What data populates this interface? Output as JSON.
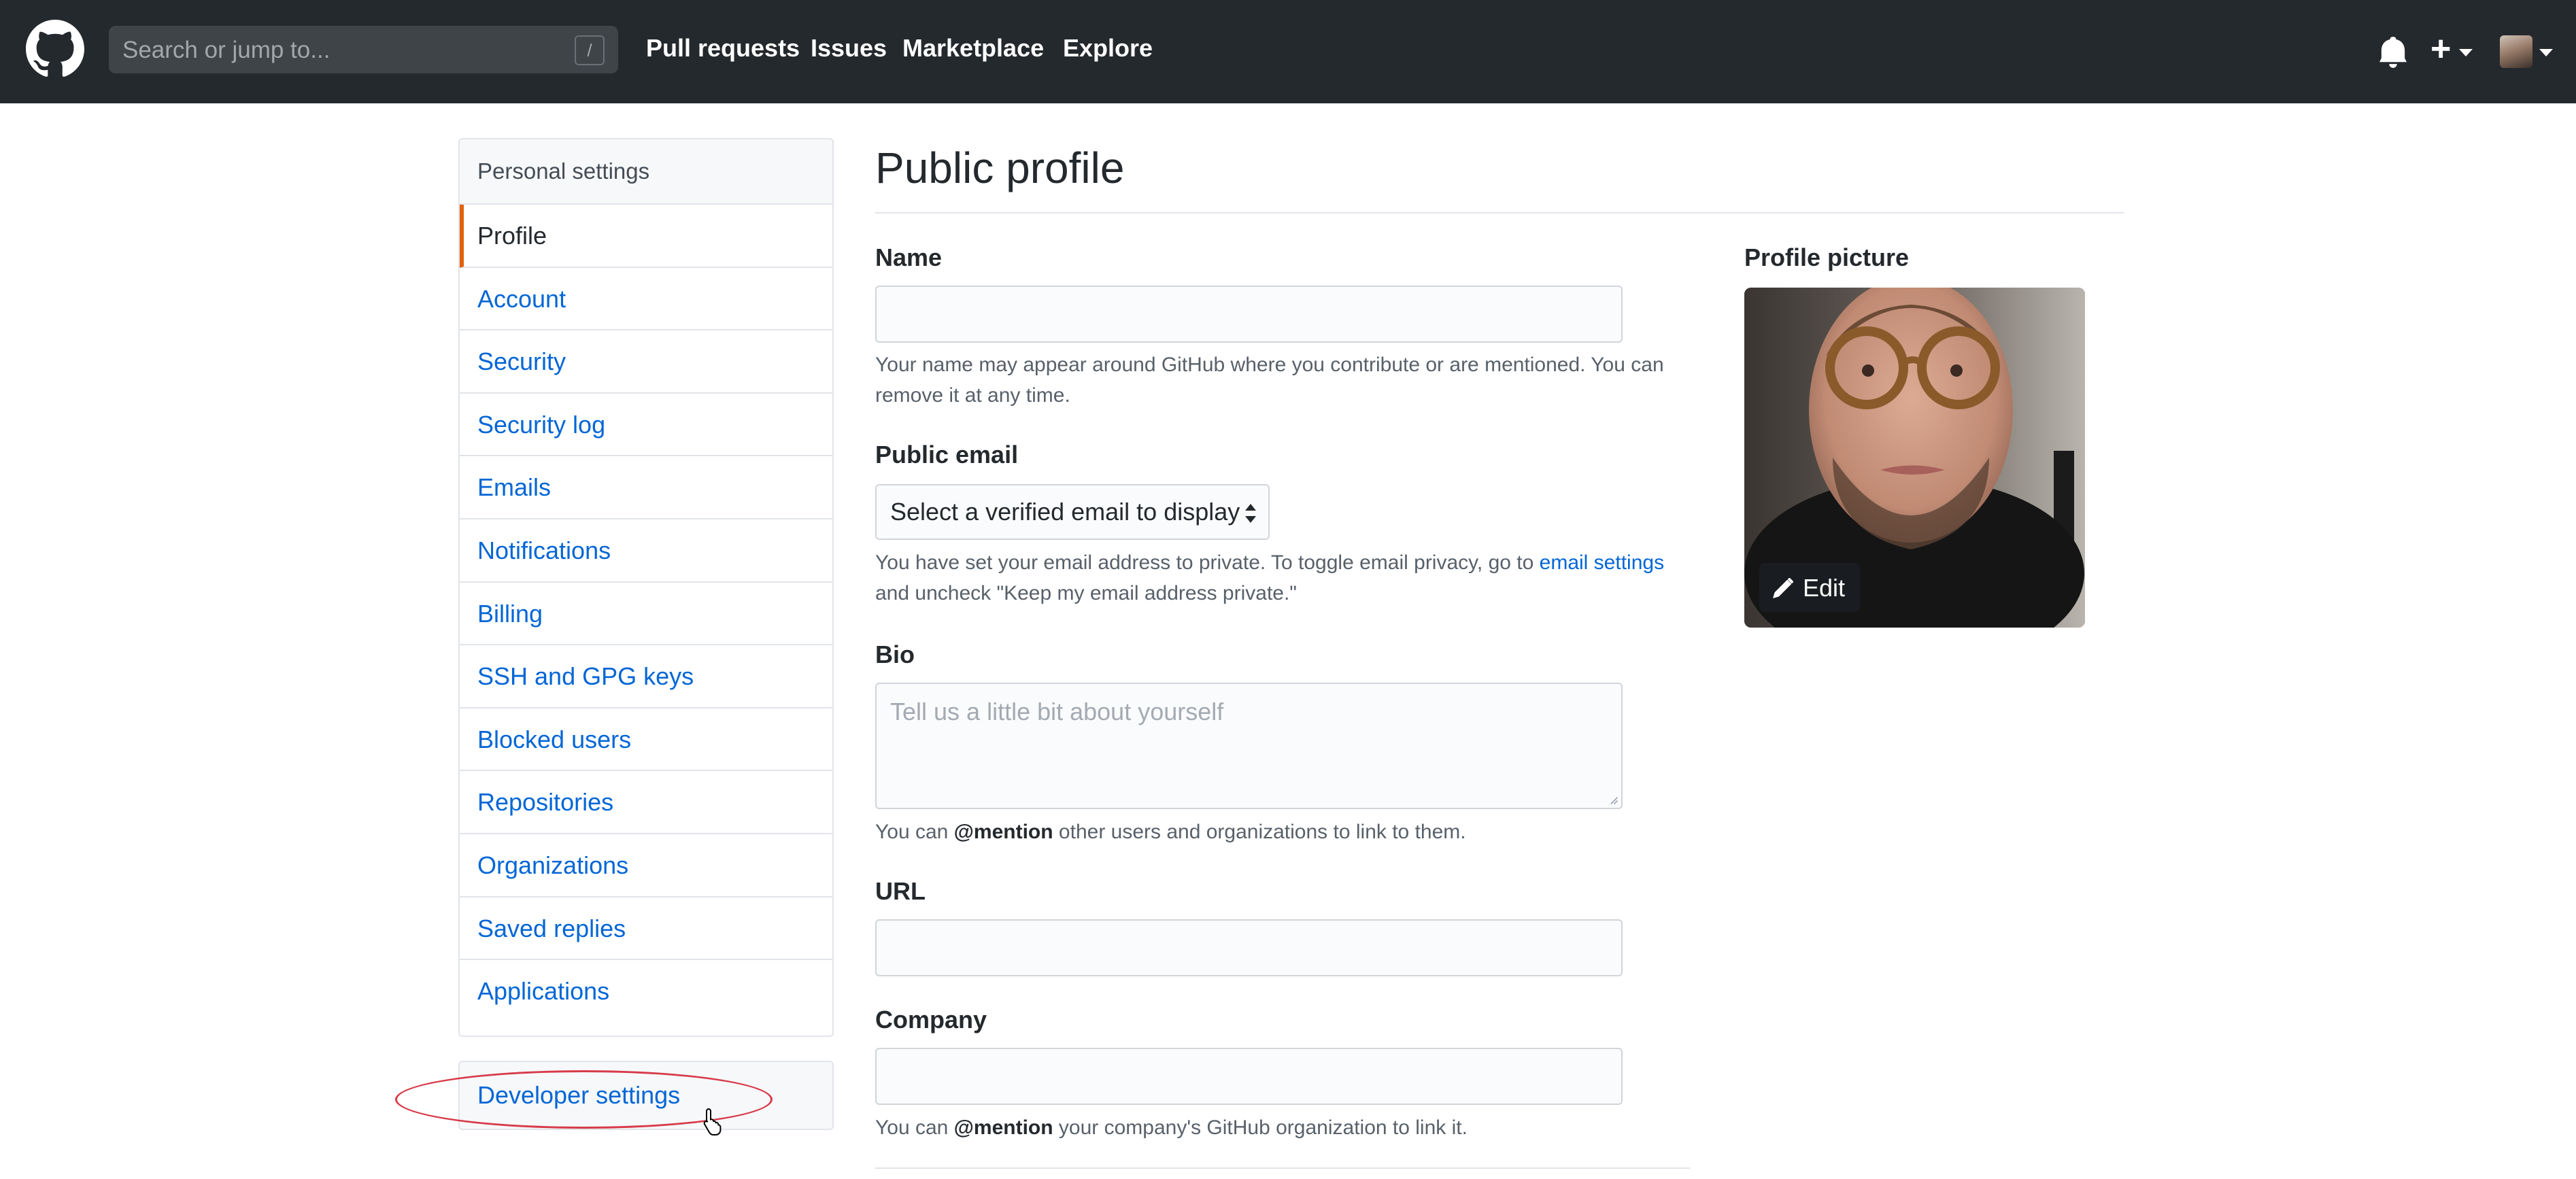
{
  "header": {
    "search_placeholder": "Search or jump to...",
    "search_shortcut": "/",
    "nav": [
      "Pull requests",
      "Issues",
      "Marketplace",
      "Explore"
    ],
    "plus_symbol": "+"
  },
  "sidebar": {
    "heading": "Personal settings",
    "items": [
      {
        "label": "Profile"
      },
      {
        "label": "Account"
      },
      {
        "label": "Security"
      },
      {
        "label": "Security log"
      },
      {
        "label": "Emails"
      },
      {
        "label": "Notifications"
      },
      {
        "label": "Billing"
      },
      {
        "label": "SSH and GPG keys"
      },
      {
        "label": "Blocked users"
      },
      {
        "label": "Repositories"
      },
      {
        "label": "Organizations"
      },
      {
        "label": "Saved replies"
      },
      {
        "label": "Applications"
      }
    ],
    "active_item": "Profile",
    "developer_settings": "Developer settings"
  },
  "main": {
    "title": "Public profile",
    "name": {
      "label": "Name",
      "value": "",
      "help": "Your name may appear around GitHub where you contribute or are mentioned. You can remove it at any time."
    },
    "public_email": {
      "label": "Public email",
      "selected": "Select a verified email to display",
      "help_before": "You have set your email address to private. To toggle email privacy, go to ",
      "help_link": "email settings",
      "help_after": "and uncheck \"Keep my email address private.\""
    },
    "bio": {
      "label": "Bio",
      "placeholder": "Tell us a little bit about yourself",
      "help_before": "You can ",
      "help_bold": "@mention",
      "help_after": " other users and organizations to link to them."
    },
    "url": {
      "label": "URL",
      "value": ""
    },
    "company": {
      "label": "Company",
      "value": "",
      "help_before": "You can ",
      "help_bold": "@mention",
      "help_after": " your company's GitHub organization to link it."
    }
  },
  "profile_picture": {
    "label": "Profile picture",
    "edit_label": "Edit"
  },
  "colors": {
    "header_bg": "#24292e",
    "link": "#0366d6",
    "active_marker": "#e36209",
    "annotation": "#d73a49"
  }
}
